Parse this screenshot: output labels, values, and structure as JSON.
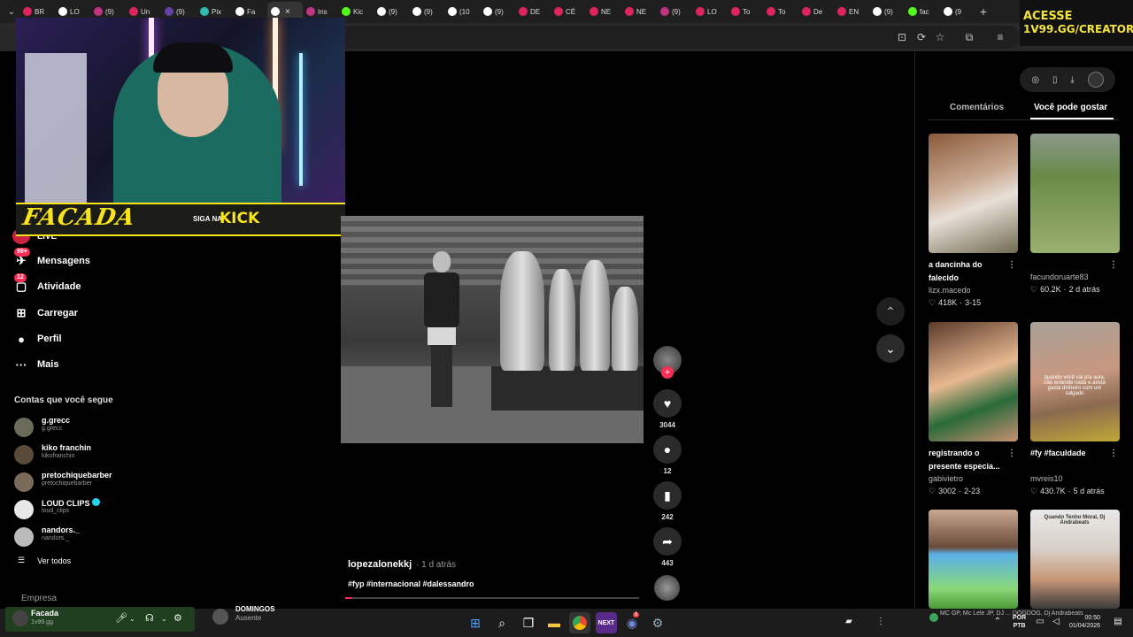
{
  "browser": {
    "tabs": [
      {
        "label": "BR",
        "color": "#e0245e"
      },
      {
        "label": "LO",
        "color": "#ffffff"
      },
      {
        "label": "(9)",
        "color": "#c13584"
      },
      {
        "label": "Un",
        "color": "#e0245e"
      },
      {
        "label": "(9)",
        "color": "#6441a5"
      },
      {
        "label": "Pix",
        "color": "#32bcad"
      },
      {
        "label": "Fa",
        "color": "#ffffff"
      },
      {
        "label": "",
        "color": "#ffffff",
        "active": true
      },
      {
        "label": "Ins",
        "color": "#c13584"
      },
      {
        "label": "Kic",
        "color": "#53fc18"
      },
      {
        "label": "(9)",
        "color": "#ffffff"
      },
      {
        "label": "(9)",
        "color": "#ffffff"
      },
      {
        "label": "(10",
        "color": "#ffffff"
      },
      {
        "label": "(9)",
        "color": "#ffffff"
      },
      {
        "label": "DE",
        "color": "#e0245e"
      },
      {
        "label": "CÉ",
        "color": "#e0245e"
      },
      {
        "label": "NE",
        "color": "#e0245e"
      },
      {
        "label": "NE",
        "color": "#e0245e"
      },
      {
        "label": "(9)",
        "color": "#c13584"
      },
      {
        "label": "LO",
        "color": "#e0245e"
      },
      {
        "label": "To",
        "color": "#e0245e"
      },
      {
        "label": "To",
        "color": "#e0245e"
      },
      {
        "label": "De",
        "color": "#e0245e"
      },
      {
        "label": "EN",
        "color": "#e0245e"
      },
      {
        "label": "(9)",
        "color": "#ffffff"
      },
      {
        "label": "fac",
        "color": "#53fc18"
      },
      {
        "label": "(9",
        "color": "#ffffff"
      }
    ],
    "tab_close": "×",
    "new_tab": "+"
  },
  "ad": {
    "line1": "ACESSE",
    "line2": "1V99.GG/CREATORS"
  },
  "overlay": {
    "brand": "FACADA",
    "siga": "SIGA NA",
    "kick": "KICK",
    "live": "LIVE"
  },
  "sidebar": {
    "items": [
      {
        "label": "Mensagens",
        "icon": "send-icon",
        "glyph": "✈",
        "badge": "99+"
      },
      {
        "label": "Atividade",
        "icon": "activity-icon",
        "glyph": "▢",
        "badge": "12"
      },
      {
        "label": "Carregar",
        "icon": "upload-icon",
        "glyph": "⊞",
        "badge": ""
      },
      {
        "label": "Perfil",
        "icon": "profile-icon",
        "glyph": "●",
        "badge": ""
      },
      {
        "label": "Mais",
        "icon": "more-icon",
        "glyph": "···",
        "badge": ""
      }
    ],
    "following_title": "Contas que você segue",
    "following": [
      {
        "name": "g.grecc",
        "handle": "g.grecc",
        "color": "#6b6b5a"
      },
      {
        "name": "kiko franchin",
        "handle": "kikofranchin",
        "color": "#5a4a3a"
      },
      {
        "name": "pretochiquebarber",
        "handle": "pretochiquebarber",
        "color": "#7a6a5a"
      },
      {
        "name": "LOUD CLIPS",
        "handle": "loud_clips",
        "color": "#e8e8e8",
        "verified": true
      },
      {
        "name": "nandors._",
        "handle": "nandors._",
        "color": "#bbbbbb"
      }
    ],
    "see_all": "Ver todos",
    "empresa": "Empresa"
  },
  "video": {
    "author": "lopezalonekkj",
    "posted": "· 1 d atrás",
    "tags": "#fyp #internacional #dalessandro",
    "progress": 0.02,
    "likes": "3044",
    "comments": "12",
    "saves": "242",
    "shares": "443"
  },
  "panel": {
    "tab_comments": "Comentários",
    "tab_suggest": "Você pode gostar",
    "cards": [
      {
        "title": "a dancinha do falecido",
        "user": "lizx.macedo",
        "likes": "418K",
        "date": "3-15",
        "bg": "linear-gradient(160deg,#8a5a3a,#c8a890 40%,#e8e0d8 60%,#706a50)"
      },
      {
        "title": "",
        "user": "facundoruarte83",
        "likes": "60.2K",
        "date": "2 d atrás",
        "bg": "linear-gradient(180deg,#8a9a8a 0%,#6a8a4a 35%,#9ab070 100%)"
      },
      {
        "title": "registrando o presente especia...",
        "user": "gabivietro",
        "likes": "3002",
        "date": "2-23",
        "bg": "linear-gradient(160deg,#5a3a2a,#e8b890 45%,#2a6a3a 70%,#c89070)"
      },
      {
        "title": "#fy #faculdade",
        "user": "mvreis10",
        "likes": "430.7K",
        "date": "5 d atrás",
        "bg": "linear-gradient(170deg,#a8a098,#c89880 45%,#8a6a50 70%,#c0a838)",
        "overlay": "quando você vai pra aula, não entende nada e ainda gasta dinheiro com um salgado"
      },
      {
        "title": "",
        "user": "",
        "likes": "",
        "date": "",
        "bg": "linear-gradient(180deg,#c8a890 0%,#6a4a3a 38%,#5ab0e8 45%,#8ad878 80%,#4a9a3a 100%)"
      },
      {
        "title": "",
        "user": "",
        "likes": "",
        "date": "",
        "bg": "linear-gradient(180deg,#e8e8e8 0%,#d8d0c8 40%,#c89878 70%,#3a3a3a 100%)",
        "overlay": "Quando Tenho Moral, Dj Andrabeats"
      }
    ]
  },
  "taskbar": {
    "user_name": "Facada",
    "user_status": "1v99.gg",
    "friend_name": "DOMINGOS",
    "friend_status": "Ausente",
    "now_playing": "MC GP, Mc Lele JP, DJ ... DOGDOG, Dj Andrabeats",
    "lang_top": "POR",
    "lang_bottom": "PTB",
    "time": "00:50",
    "date": "01/04/2026",
    "discord_badge": "9"
  }
}
